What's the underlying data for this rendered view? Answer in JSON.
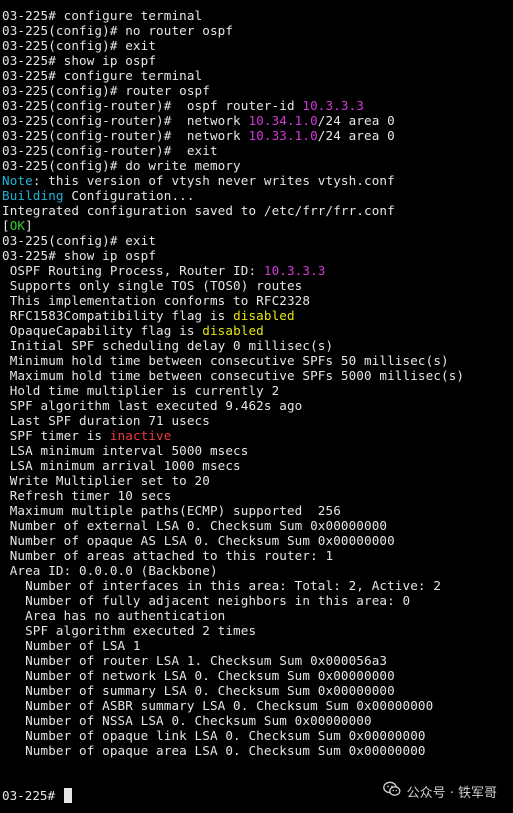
{
  "colors": {
    "default": "#e6e6e6",
    "magenta": "#d13ad8",
    "cyan": "#21b3d6",
    "yellow": "#e5e510",
    "green": "#2fd12f",
    "red": "#ee3a3a",
    "background": "#000000"
  },
  "lines": [
    [
      {
        "text": "03-225# configure terminal"
      }
    ],
    [
      {
        "text": "03-225(config)# no router ospf"
      }
    ],
    [
      {
        "text": "03-225(config)# exit"
      }
    ],
    [
      {
        "text": "03-225# show ip ospf"
      }
    ],
    [
      {
        "text": "03-225# configure terminal"
      }
    ],
    [
      {
        "text": "03-225(config)# router ospf"
      }
    ],
    [
      {
        "text": "03-225(config-router)#  ospf router-id "
      },
      {
        "text": "10.3.3.3",
        "color": "magenta"
      }
    ],
    [
      {
        "text": "03-225(config-router)#  network "
      },
      {
        "text": "10.34.1.0",
        "color": "magenta"
      },
      {
        "text": "/24 area 0"
      }
    ],
    [
      {
        "text": "03-225(config-router)#  network "
      },
      {
        "text": "10.33.1.0",
        "color": "magenta"
      },
      {
        "text": "/24 area 0"
      }
    ],
    [
      {
        "text": "03-225(config-router)#  exit"
      }
    ],
    [
      {
        "text": "03-225(config)# do write memory"
      }
    ],
    [
      {
        "text": "Note",
        "color": "cyan"
      },
      {
        "text": ": this version of vtysh never writes vtysh.conf"
      }
    ],
    [
      {
        "text": "Building",
        "color": "cyan"
      },
      {
        "text": " Configuration..."
      }
    ],
    [
      {
        "text": "Integrated configuration saved to /etc/frr/frr.conf"
      }
    ],
    [
      {
        "text": "[",
        "color": "default"
      },
      {
        "text": "OK",
        "color": "green"
      },
      {
        "text": "]"
      }
    ],
    [
      {
        "text": "03-225(config)# exit"
      }
    ],
    [
      {
        "text": "03-225# show ip ospf"
      }
    ],
    [
      {
        "text": " OSPF Routing Process, Router ID: "
      },
      {
        "text": "10.3.3.3",
        "color": "magenta"
      }
    ],
    [
      {
        "text": " Supports only single TOS (TOS0) routes"
      }
    ],
    [
      {
        "text": " This implementation conforms to RFC2328"
      }
    ],
    [
      {
        "text": " RFC1583Compatibility flag is "
      },
      {
        "text": "disabled",
        "color": "yellow"
      }
    ],
    [
      {
        "text": " OpaqueCapability flag is "
      },
      {
        "text": "disabled",
        "color": "yellow"
      }
    ],
    [
      {
        "text": " Initial SPF scheduling delay 0 millisec(s)"
      }
    ],
    [
      {
        "text": " Minimum hold time between consecutive SPFs 50 millisec(s)"
      }
    ],
    [
      {
        "text": " Maximum hold time between consecutive SPFs 5000 millisec(s)"
      }
    ],
    [
      {
        "text": " Hold time multiplier is currently 2"
      }
    ],
    [
      {
        "text": " SPF algorithm last executed 9.462s ago"
      }
    ],
    [
      {
        "text": " Last SPF duration 71 usecs"
      }
    ],
    [
      {
        "text": " SPF timer is "
      },
      {
        "text": "inactive",
        "color": "red"
      }
    ],
    [
      {
        "text": " LSA minimum interval 5000 msecs"
      }
    ],
    [
      {
        "text": " LSA minimum arrival 1000 msecs"
      }
    ],
    [
      {
        "text": " Write Multiplier set to 20"
      }
    ],
    [
      {
        "text": " Refresh timer 10 secs"
      }
    ],
    [
      {
        "text": " Maximum multiple paths(ECMP) supported  256"
      }
    ],
    [
      {
        "text": " Number of external LSA 0. Checksum Sum 0x00000000"
      }
    ],
    [
      {
        "text": " Number of opaque AS LSA 0. Checksum Sum 0x00000000"
      }
    ],
    [
      {
        "text": " Number of areas attached to this router: 1"
      }
    ],
    [
      {
        "text": " Area ID: 0.0.0.0 (Backbone)"
      }
    ],
    [
      {
        "text": "   Number of interfaces in this area: Total: 2, Active: 2"
      }
    ],
    [
      {
        "text": "   Number of fully adjacent neighbors in this area: 0"
      }
    ],
    [
      {
        "text": "   Area has no authentication"
      }
    ],
    [
      {
        "text": "   SPF algorithm executed 2 times"
      }
    ],
    [
      {
        "text": "   Number of LSA 1"
      }
    ],
    [
      {
        "text": "   Number of router LSA 1. Checksum Sum 0x000056a3"
      }
    ],
    [
      {
        "text": "   Number of network LSA 0. Checksum Sum 0x00000000"
      }
    ],
    [
      {
        "text": "   Number of summary LSA 0. Checksum Sum 0x00000000"
      }
    ],
    [
      {
        "text": "   Number of ASBR summary LSA 0. Checksum Sum 0x00000000"
      }
    ],
    [
      {
        "text": "   Number of NSSA LSA 0. Checksum Sum 0x00000000"
      }
    ],
    [
      {
        "text": "   Number of opaque link LSA 0. Checksum Sum 0x00000000"
      }
    ],
    [
      {
        "text": "   Number of opaque area LSA 0. Checksum Sum 0x00000000"
      }
    ]
  ],
  "prompt": "03-225# ",
  "watermark": {
    "icon": "wechat-icon",
    "text": "公众号 · 铁军哥"
  }
}
